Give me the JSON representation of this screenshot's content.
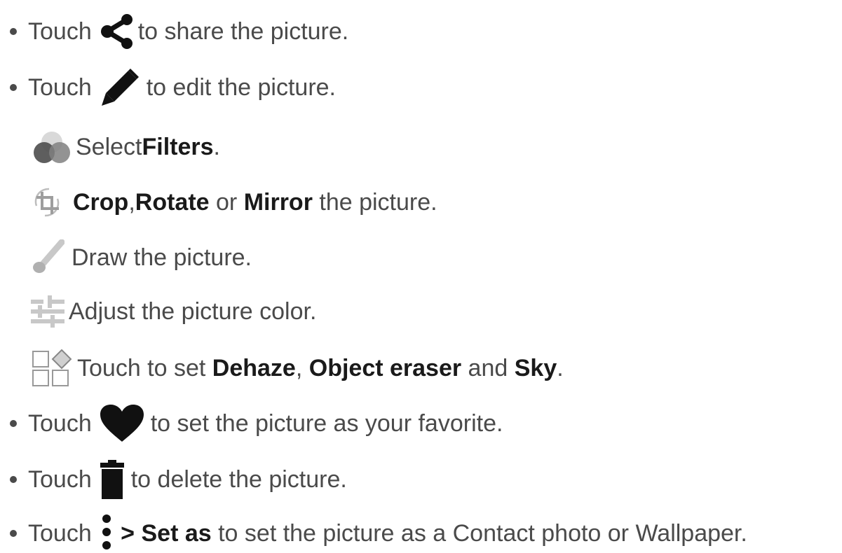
{
  "items": [
    {
      "prefix": "Touch",
      "icon": "share-icon",
      "suffix": " to share the picture."
    },
    {
      "prefix": "Touch",
      "icon": "pencil-icon",
      "suffix": " to edit the picture."
    }
  ],
  "sub_items": [
    {
      "icon": "filters-icon",
      "parts": [
        "Select ",
        "Filters",
        "."
      ]
    },
    {
      "icon": "crop-rotate-icon",
      "parts": [
        "Crop",
        ", ",
        "Rotate",
        " or ",
        "Mirror",
        " the picture."
      ]
    },
    {
      "icon": "brush-icon",
      "parts": [
        "Draw the picture."
      ]
    },
    {
      "icon": "adjust-icon",
      "parts": [
        "Adjust the picture color."
      ]
    },
    {
      "icon": "tools-grid-icon",
      "parts": [
        "Touch to set ",
        "Dehaze",
        ", ",
        "Object eraser",
        " and ",
        "Sky",
        "."
      ]
    }
  ],
  "items2": [
    {
      "prefix": "Touch",
      "icon": "heart-icon",
      "suffix": " to set the picture as your favorite."
    },
    {
      "prefix": "Touch",
      "icon": "trash-icon",
      "suffix": " to delete the picture."
    },
    {
      "prefix": "Touch",
      "icon": "more-vert-icon",
      "bold": " > Set as",
      "suffix": " to set the picture as a Contact photo or Wallpaper."
    }
  ]
}
